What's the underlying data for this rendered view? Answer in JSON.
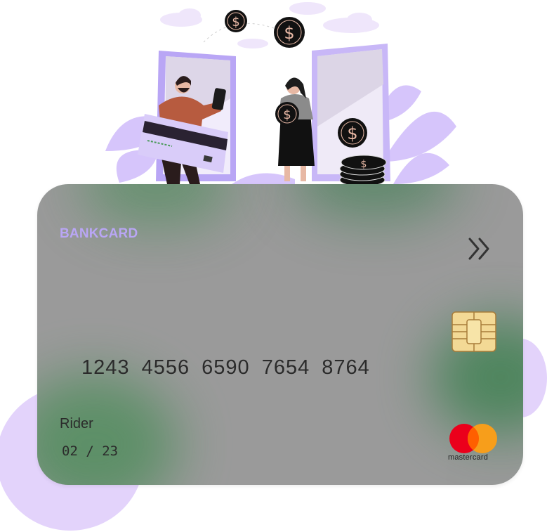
{
  "card": {
    "brand": "BANKCARD",
    "number": "1243  4556  6590  7654  8764",
    "holder": "Rider",
    "expiry": "02 / 23",
    "network": "mastercard"
  },
  "icons": [
    "double-chevron-right-icon",
    "chip-icon",
    "mastercard-logo",
    "dollar-coin-icon"
  ],
  "colors": {
    "card": "#9a9a9a",
    "brand": "#b9a6f5",
    "lavender": "#e3d3fb",
    "phone": "#b9a6f5",
    "coin": "#111111",
    "mastercard_red": "#eb001b",
    "mastercard_orange": "#f79e1b"
  }
}
